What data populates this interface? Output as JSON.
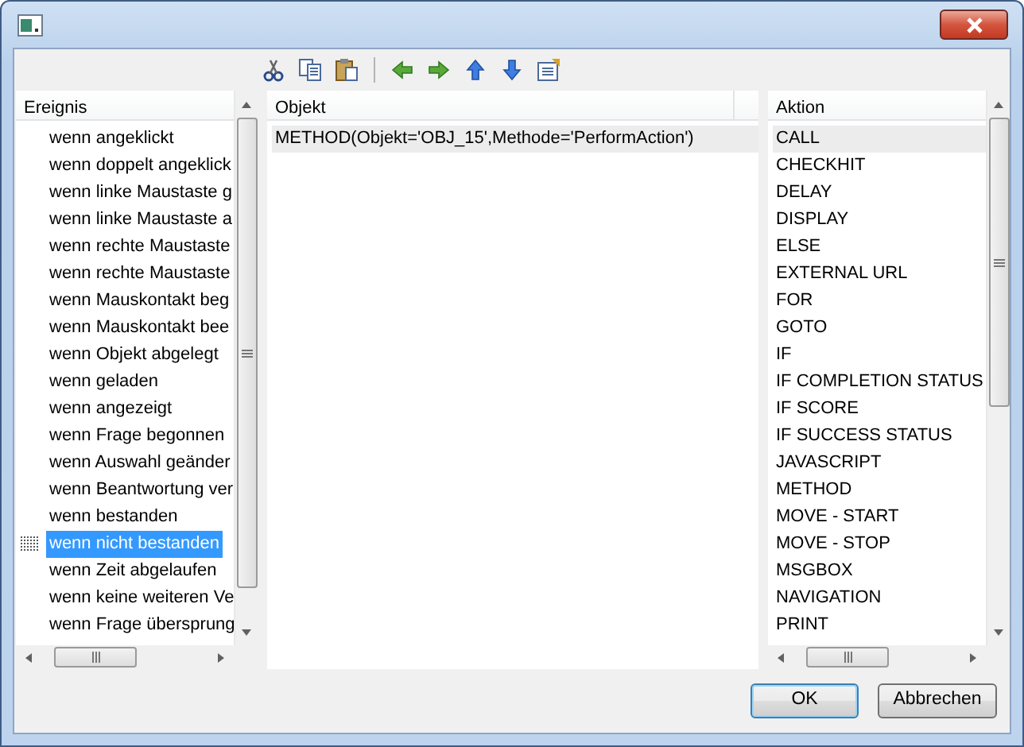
{
  "events": {
    "header": "Ereignis",
    "focused": true,
    "items": [
      {
        "label": "wenn angeklickt",
        "selected": false
      },
      {
        "label": "wenn doppelt angeklick",
        "selected": false
      },
      {
        "label": "wenn linke Maustaste g",
        "selected": false
      },
      {
        "label": "wenn linke Maustaste a",
        "selected": false
      },
      {
        "label": "wenn rechte Maustaste",
        "selected": false
      },
      {
        "label": "wenn rechte Maustaste",
        "selected": false
      },
      {
        "label": "wenn Mauskontakt beg",
        "selected": false
      },
      {
        "label": "wenn Mauskontakt bee",
        "selected": false
      },
      {
        "label": "wenn Objekt abgelegt",
        "selected": false
      },
      {
        "label": "wenn geladen",
        "selected": false
      },
      {
        "label": "wenn angezeigt",
        "selected": false
      },
      {
        "label": "wenn Frage begonnen",
        "selected": false
      },
      {
        "label": "wenn Auswahl geänder",
        "selected": false
      },
      {
        "label": "wenn Beantwortung ver",
        "selected": false
      },
      {
        "label": "wenn bestanden",
        "selected": false
      },
      {
        "label": "wenn nicht bestanden",
        "selected": true
      },
      {
        "label": "wenn Zeit abgelaufen",
        "selected": false
      },
      {
        "label": "wenn keine weiteren Ve",
        "selected": false
      },
      {
        "label": "wenn Frage übersprung",
        "selected": false
      }
    ]
  },
  "objects": {
    "header": "Objekt",
    "focused": false,
    "items": [
      {
        "label": "METHOD(Objekt='OBJ_15',Methode='PerformAction')",
        "selected": true
      }
    ]
  },
  "actions": {
    "header": "Aktion",
    "focused": false,
    "items": [
      {
        "label": "CALL",
        "selected": true
      },
      {
        "label": "CHECKHIT",
        "selected": false
      },
      {
        "label": "DELAY",
        "selected": false
      },
      {
        "label": "DISPLAY",
        "selected": false
      },
      {
        "label": "ELSE",
        "selected": false
      },
      {
        "label": "EXTERNAL URL",
        "selected": false
      },
      {
        "label": "FOR",
        "selected": false
      },
      {
        "label": "GOTO",
        "selected": false
      },
      {
        "label": "IF",
        "selected": false
      },
      {
        "label": "IF COMPLETION STATUS",
        "selected": false
      },
      {
        "label": "IF SCORE",
        "selected": false
      },
      {
        "label": "IF SUCCESS STATUS",
        "selected": false
      },
      {
        "label": "JAVASCRIPT",
        "selected": false
      },
      {
        "label": "METHOD",
        "selected": false
      },
      {
        "label": "MOVE - START",
        "selected": false
      },
      {
        "label": "MOVE - STOP",
        "selected": false
      },
      {
        "label": "MSGBOX",
        "selected": false
      },
      {
        "label": "NAVIGATION",
        "selected": false
      },
      {
        "label": "PRINT",
        "selected": false
      }
    ]
  },
  "buttons": [
    {
      "label": "OK",
      "default": true
    },
    {
      "label": "Abbrechen",
      "default": false
    }
  ]
}
